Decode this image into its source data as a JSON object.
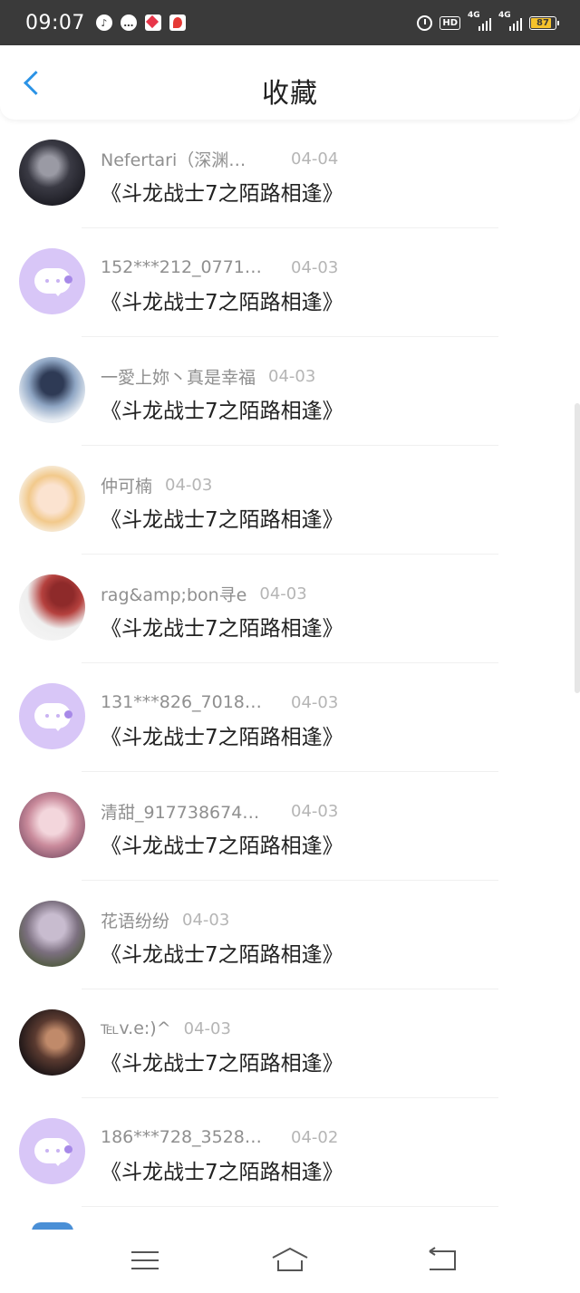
{
  "status_bar": {
    "time": "09:07",
    "battery": "87",
    "network_1": "4G",
    "network_2": "4G",
    "hd_label": "HD",
    "icons": [
      "music-icon",
      "chat-bubble-icon",
      "app-icon",
      "map-pin-app-icon",
      "alarm-icon",
      "hd-icon",
      "signal-icon",
      "battery-icon"
    ],
    "battery_color": "#f5c22b"
  },
  "header": {
    "title": "收藏",
    "accent": "#2b93e6"
  },
  "items": [
    {
      "author": "Nefertari（深渊…",
      "date": "04-04",
      "title": "《斗龙战士7之陌路相逢》",
      "avatar": "photo-dark"
    },
    {
      "author": "152***212_0771…",
      "date": "04-03",
      "title": "《斗龙战士7之陌路相逢》",
      "avatar": "default"
    },
    {
      "author": "一愛上妳丶真是幸福",
      "date": "04-03",
      "title": "《斗龙战士7之陌路相逢》",
      "avatar": "photo-anime-blue"
    },
    {
      "author": "仲可楠",
      "date": "04-03",
      "title": "《斗龙战士7之陌路相逢》",
      "avatar": "photo-anime-yellow"
    },
    {
      "author": "rag&amp;bon寻e",
      "date": "04-03",
      "title": "《斗龙战士7之陌路相逢》",
      "avatar": "photo-red-hat"
    },
    {
      "author": "131***826_7018…",
      "date": "04-03",
      "title": "《斗龙战士7之陌路相逢》",
      "avatar": "default"
    },
    {
      "author": "清甜_917738674…",
      "date": "04-03",
      "title": "《斗龙战士7之陌路相逢》",
      "avatar": "photo-anime-pink"
    },
    {
      "author": "花语纷纷",
      "date": "04-03",
      "title": "《斗龙战士7之陌路相逢》",
      "avatar": "photo-tree"
    },
    {
      "author": "℡v.e:)^",
      "date": "04-03",
      "title": "《斗龙战士7之陌路相逢》",
      "avatar": "photo-portrait"
    },
    {
      "author": "186***728_3528…",
      "date": "04-02",
      "title": "《斗龙战士7之陌路相逢》",
      "avatar": "default"
    }
  ],
  "default_avatar_color": "#d8c6f7",
  "nav": {
    "icons": [
      "menu-icon",
      "home-icon",
      "back-icon"
    ]
  }
}
